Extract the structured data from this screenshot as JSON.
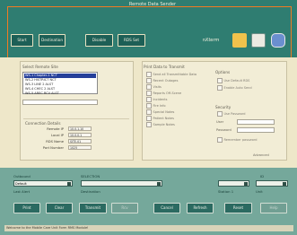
{
  "app": {
    "title": "Remote Data Sender"
  },
  "toolbar": {
    "buttons": [
      {
        "label": "Start"
      },
      {
        "label": "Destination"
      },
      {
        "label": "Disable"
      },
      {
        "label": "RDS Set"
      }
    ],
    "brand": "nXterm"
  },
  "main": {
    "left_section_title": "Select Remote Site",
    "remote_list": [
      "WS-1 Chapter-1 NCT",
      "WS-2 HISTRICT NCT",
      "WS-3 LINE 2 ALST",
      "WS-4 CHEC 2 ALST",
      "WS-5 AREC RCV ALST"
    ],
    "connection": {
      "title": "Connection Details",
      "rows": [
        {
          "label": "Remote IP",
          "value": "10.0.1.10"
        },
        {
          "label": "Local IP",
          "value": "10.0.0.1"
        },
        {
          "label": "RDS Name",
          "value": "SITE-01"
        },
        {
          "label": "Port Number",
          "value": "1025"
        }
      ]
    },
    "filter_section_title": "Print Data to Transmit",
    "filter_options": [
      "Send all Transmittable Data",
      "Recent Outages",
      "Visits",
      "Reports Off-Scene",
      "Incidents",
      "Fire Info",
      "Special Notes",
      "Patient Notes",
      "Sample Notes"
    ],
    "options_title": "Options",
    "options": [
      "Use Default RDS",
      "Enable Auto Send"
    ],
    "security_title": "Security",
    "security": {
      "option": "Use Password",
      "user_label": "User",
      "password_label": "Password",
      "remember": "Remember password"
    },
    "advanced_button": "Advanced"
  },
  "bottom": {
    "outbound_label": "Outbound",
    "outbound_value": "Default",
    "last_alert_label": "Last Alert",
    "selection_label": "SELECTION",
    "selection_value": "",
    "destination_label": "Destination",
    "right_value_1_label": "Station 1",
    "right_value_2_label": "Unit",
    "right_value_3_label": "ID",
    "buttons": [
      {
        "label": "Print",
        "enabled": true
      },
      {
        "label": "Clear",
        "enabled": true
      },
      {
        "label": "Transmit",
        "enabled": true
      },
      {
        "label": "Rcv",
        "enabled": false
      },
      {
        "label": "Cancel",
        "enabled": true
      },
      {
        "label": "Refresh",
        "enabled": true
      },
      {
        "label": "Reset",
        "enabled": true
      },
      {
        "label": "Help",
        "enabled": false
      }
    ],
    "status": "Welcome to the Mobile Care Unit Form RMS Module!"
  }
}
